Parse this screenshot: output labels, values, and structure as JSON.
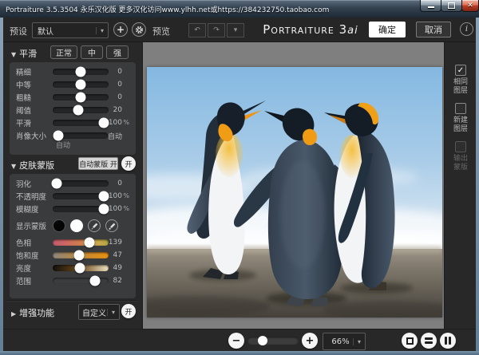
{
  "window": {
    "title": "Portraiture 3.5.3504 永乐汉化版  更多汉化访问www.ylhh.net或https://384232750.taobao.com"
  },
  "icons": {
    "plus": "+",
    "minus": "−",
    "undo": "↶",
    "redo": "↷",
    "arrow_down": "▾",
    "info": "i",
    "check": "✓"
  },
  "toolbar": {
    "preset_label": "预设",
    "preset_value": "默认",
    "preview_label": "预览",
    "logo_main": "Portraiture 3",
    "logo_suffix": "ai",
    "ok": "确定",
    "cancel": "取消"
  },
  "smoothing": {
    "collapse": "▼",
    "title": "平滑",
    "preset_buttons": [
      "正常",
      "中",
      "强"
    ],
    "sliders": [
      {
        "label": "精细",
        "value": "0",
        "unit": ""
      },
      {
        "label": "中等",
        "value": "0",
        "unit": ""
      },
      {
        "label": "粗糙",
        "value": "0",
        "unit": ""
      },
      {
        "label": "阈值",
        "value": "20",
        "unit": ""
      },
      {
        "label": "平滑",
        "value": "100",
        "unit": "%"
      },
      {
        "label": "肖像大小",
        "value": "自动",
        "unit": "",
        "sub_label": "自动"
      }
    ]
  },
  "skin_mask": {
    "collapse": "▼",
    "title": "皮肤蒙版",
    "auto_mask_button": "自动蒙版 开",
    "power_toggle": "开",
    "sliders": [
      {
        "label": "羽化",
        "value": "0",
        "unit": ""
      },
      {
        "label": "不透明度",
        "value": "100",
        "unit": "%"
      },
      {
        "label": "模糊度",
        "value": "100",
        "unit": "%"
      }
    ],
    "show_mask_label": "显示蒙版",
    "color_sliders": [
      {
        "label": "色相",
        "value": "139"
      },
      {
        "label": "饱和度",
        "value": "47"
      },
      {
        "label": "亮度",
        "value": "49"
      },
      {
        "label": "范围",
        "value": "82"
      }
    ]
  },
  "enhance": {
    "collapse": "▶",
    "title": "增强功能",
    "dropdown_value": "自定义",
    "power_toggle": "开"
  },
  "output_options": {
    "items": [
      {
        "line1": "相同",
        "line2": "图层",
        "check": "✓"
      },
      {
        "line1": "新建",
        "line2": "图层",
        "check": ""
      },
      {
        "line1": "输出",
        "line2": "蒙版",
        "check": ""
      }
    ]
  },
  "bottom_bar": {
    "zoom_value": "66%"
  },
  "colors": {
    "accent_orange": "#f09c14",
    "ok_button": "#ffffff",
    "close_button": "#c13e24",
    "panel_background": "#282828",
    "canvas_background": "#7f7f7f"
  }
}
